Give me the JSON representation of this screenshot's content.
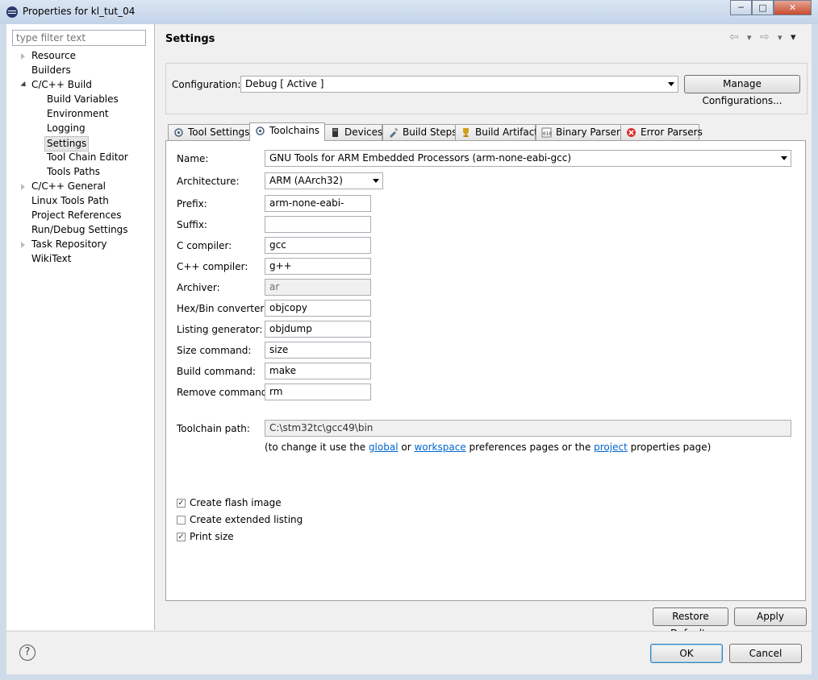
{
  "window": {
    "title": "Properties for kl_tut_04",
    "minimize": "─",
    "maximize": "□",
    "close": "✕"
  },
  "filter": {
    "placeholder": "type filter text"
  },
  "tree": [
    {
      "label": "Resource",
      "expander": "closed"
    },
    {
      "label": "Builders",
      "expander": "none"
    },
    {
      "label": "C/C++ Build",
      "expander": "open"
    },
    {
      "label": "Build Variables",
      "expander": "none"
    },
    {
      "label": "Environment",
      "expander": "none"
    },
    {
      "label": "Logging",
      "expander": "none"
    },
    {
      "label": "Settings",
      "expander": "none",
      "selected": true
    },
    {
      "label": "Tool Chain Editor",
      "expander": "none"
    },
    {
      "label": "Tools Paths",
      "expander": "none"
    },
    {
      "label": "C/C++ General",
      "expander": "closed"
    },
    {
      "label": "Linux Tools Path",
      "expander": "none"
    },
    {
      "label": "Project References",
      "expander": "none"
    },
    {
      "label": "Run/Debug Settings",
      "expander": "none"
    },
    {
      "label": "Task Repository",
      "expander": "closed"
    },
    {
      "label": "WikiText",
      "expander": "none"
    }
  ],
  "page": {
    "title": "Settings",
    "nav_back": "⇦",
    "nav_forward": "⇨",
    "nav_menu": "▾"
  },
  "configuration": {
    "label": "Configuration:",
    "value": "Debug  [ Active ]",
    "manage_button": "Manage Configurations..."
  },
  "tabs": [
    {
      "label": "Tool Settings",
      "icon": "tool-settings-icon",
      "active": false
    },
    {
      "label": "Toolchains",
      "icon": "toolchains-icon",
      "active": true
    },
    {
      "label": "Devices",
      "icon": "devices-icon",
      "active": false
    },
    {
      "label": "Build Steps",
      "icon": "build-steps-icon",
      "active": false
    },
    {
      "label": "Build Artifact",
      "icon": "build-artifact-icon",
      "active": false
    },
    {
      "label": "Binary Parsers",
      "icon": "binary-parsers-icon",
      "active": false
    },
    {
      "label": "Error Parsers",
      "icon": "error-parsers-icon",
      "active": false
    }
  ],
  "toolchain": {
    "name_label": "Name:",
    "name_value": "GNU Tools for ARM Embedded Processors (arm-none-eabi-gcc)",
    "architecture_label": "Architecture:",
    "architecture_value": "ARM (AArch32)",
    "fields": [
      {
        "label": "Prefix:",
        "value": "arm-none-eabi-",
        "disabled": false
      },
      {
        "label": "Suffix:",
        "value": "",
        "disabled": false
      },
      {
        "label": "C compiler:",
        "value": "gcc",
        "disabled": false
      },
      {
        "label": "C++ compiler:",
        "value": "g++",
        "disabled": false
      },
      {
        "label": "Archiver:",
        "value": "ar",
        "disabled": true
      },
      {
        "label": "Hex/Bin converter:",
        "value": "objcopy",
        "disabled": false
      },
      {
        "label": "Listing generator:",
        "value": "objdump",
        "disabled": false
      },
      {
        "label": "Size command:",
        "value": "size",
        "disabled": false
      },
      {
        "label": "Build command:",
        "value": "make",
        "disabled": false
      },
      {
        "label": "Remove command:",
        "value": "rm",
        "disabled": false
      }
    ],
    "path_label": "Toolchain path:",
    "path_value": "C:\\stm32tc\\gcc49\\bin",
    "help": {
      "prefix": "(to change it use the ",
      "link_global": "global",
      "or": " or ",
      "link_workspace": "workspace",
      "middle": " preferences pages or the ",
      "link_project": "project",
      "suffix": " properties page)"
    },
    "checkboxes": [
      {
        "label": "Create flash image",
        "checked": true
      },
      {
        "label": "Create extended listing",
        "checked": false
      },
      {
        "label": "Print size",
        "checked": true
      }
    ]
  },
  "buttons": {
    "restore_defaults": "Restore Defaults",
    "apply": "Apply",
    "ok": "OK",
    "cancel": "Cancel",
    "help": "?"
  },
  "colors": {
    "link": "#0066cc",
    "selection": "#e6e6e6",
    "error_icon": "#d9302c",
    "trophy_icon": "#d4a017"
  }
}
